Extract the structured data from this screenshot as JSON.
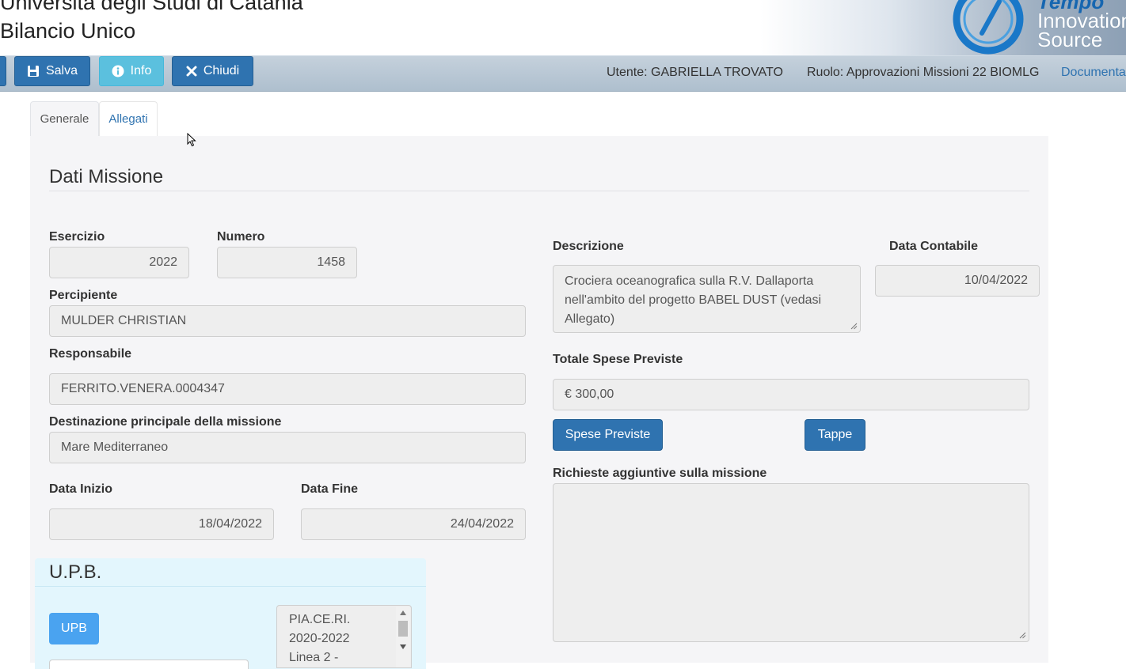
{
  "header": {
    "org_name": "Università degli Studi di Catania",
    "app_name": "Bilancio Unico",
    "logo": {
      "line1": "Tempo",
      "line2": "Innovation",
      "line3": "Source",
      "icon": "clock-swoosh-logo"
    }
  },
  "toolbar": {
    "salva_label": "Salva",
    "info_label": "Info",
    "chiudi_label": "Chiudi",
    "utente": "Utente: GABRIELLA TROVATO",
    "ruolo": "Ruolo: Approvazioni Missioni 22 BIOMLG",
    "documenta_link": "Documenta"
  },
  "tabs": [
    {
      "label": "Generale",
      "active": true
    },
    {
      "label": "Allegati",
      "active": false
    }
  ],
  "form": {
    "section_title": "Dati Missione",
    "esercizio": {
      "label": "Esercizio",
      "value": "2022"
    },
    "numero": {
      "label": "Numero",
      "value": "1458"
    },
    "percipiente": {
      "label": "Percipiente",
      "value": "MULDER CHRISTIAN"
    },
    "responsabile": {
      "label": "Responsabile",
      "value": "FERRITO.VENERA.0004347"
    },
    "destinazione": {
      "label": "Destinazione principale della missione",
      "value": "Mare Mediterraneo"
    },
    "data_inizio": {
      "label": "Data Inizio",
      "value": "18/04/2022"
    },
    "data_fine": {
      "label": "Data Fine",
      "value": "24/04/2022"
    },
    "descrizione": {
      "label": "Descrizione",
      "lines": [
        "Crociera oceanografica sulla R.V. Dallaporta",
        "nell'ambito del progetto BABEL DUST (vedasi",
        "Allegato)"
      ]
    },
    "data_contabile": {
      "label": "Data Contabile",
      "value": "10/04/2022"
    },
    "totale_spese": {
      "label": "Totale Spese Previste",
      "value": "€ 300,00"
    },
    "spese_previste_button": "Spese Previste",
    "tappe_button": "Tappe",
    "richieste": {
      "label": "Richieste aggiuntive sulla missione",
      "value": ""
    }
  },
  "upb": {
    "title": "U.P.B.",
    "button": "UPB",
    "options_visible": [
      "PIA.CE.RI.",
      "2020-2022",
      "Linea 2 -"
    ]
  },
  "colors": {
    "primary": "#2f73b0",
    "info": "#5bc0de",
    "upb_button": "#4aa3f0",
    "panel_bg": "#f5f5f7",
    "upb_bg": "#e3f6fd"
  }
}
